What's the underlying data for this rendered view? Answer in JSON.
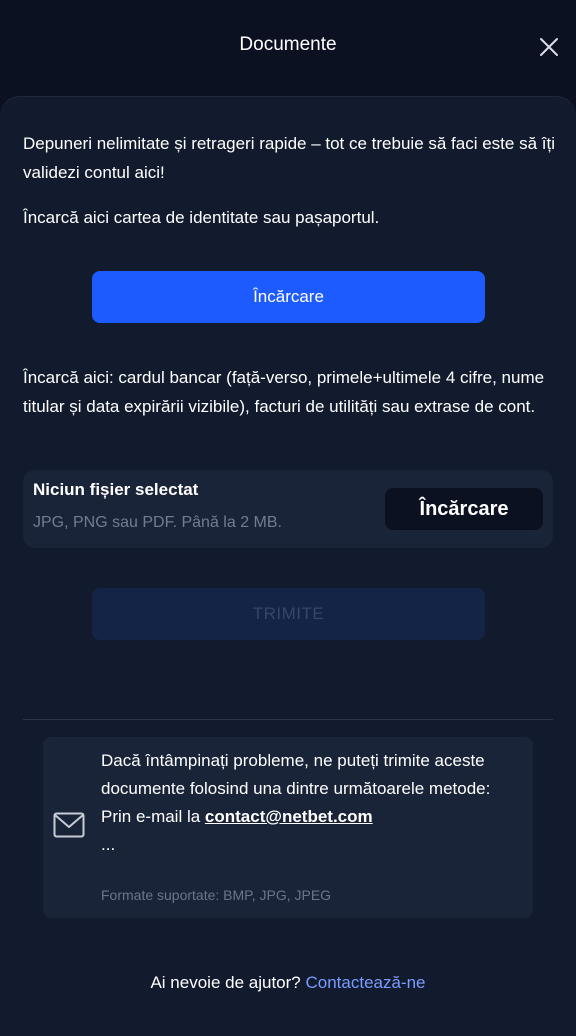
{
  "header": {
    "title": "Documente",
    "close_icon": "close-icon"
  },
  "intro": {
    "text": "Depuneri nelimitate și retrageri rapide – tot ce trebuie să faci este să îți validezi contul aici!"
  },
  "id_section": {
    "hint": "Încarcă aici cartea de identitate sau pașaportul.",
    "upload_label": "Încărcare"
  },
  "bank_section": {
    "hint": "Încarcă aici: cardul bancar (față-verso, primele+ultimele 4 cifre, nume titular și data expirării vizibile), facturi de utilități sau extrase de cont.",
    "file_status": "Niciun fișier selectat",
    "file_hint": "JPG, PNG sau PDF. Până la 2 MB.",
    "upload_label": "Încărcare"
  },
  "submit": {
    "label": "TRIMITE"
  },
  "contact": {
    "icon": "mail-icon",
    "text_line1": "Dacă întâmpinați probleme, ne puteți trimite aceste documente folosind una dintre următoarele metode:",
    "email_prefix": "Prin e-mail la ",
    "email": "contact@netbet.com",
    "ellipsis": "...",
    "formats": "Formate suportate: BMP, JPG, JPEG"
  },
  "help": {
    "question": "Ai nevoie de ajutor?",
    "link": "Contactează-ne"
  },
  "colors": {
    "background": "#0b1120",
    "panel": "#121b2e",
    "primary": "#1d5bff",
    "disabled": "#142447",
    "link": "#7a9bff"
  }
}
